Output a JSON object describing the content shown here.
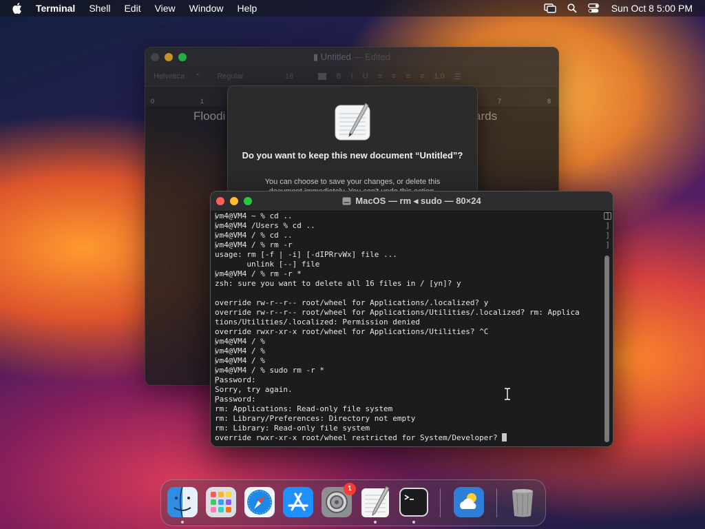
{
  "menubar": {
    "app_name": "Terminal",
    "items": [
      "Shell",
      "Edit",
      "View",
      "Window",
      "Help"
    ],
    "clock": "Sun Oct 8  5:00 PM"
  },
  "textedit": {
    "title": "Untitled",
    "title_suffix": " — Edited",
    "toolbar": {
      "font": "Helvetica",
      "style": "Regular",
      "size": "18",
      "spacing": "1.0"
    },
    "ruler_ticks": [
      "0",
      "1",
      "7",
      "8"
    ],
    "doc_text_left": "Floodi",
    "doc_text_right": "ards"
  },
  "save_sheet": {
    "heading": "Do you want to keep this new document “Untitled”?",
    "body": "You can choose to save your changes, or delete this document immediately. You can't undo this action."
  },
  "terminal": {
    "title": "MacOS — rm ◂ sudo — 80×24",
    "lines": [
      {
        "text": "vm4@VM4 ~ % cd ..",
        "mark": true
      },
      {
        "text": "vm4@VM4 /Users % cd ..",
        "mark": true
      },
      {
        "text": "vm4@VM4 / % cd ..",
        "mark": true
      },
      {
        "text": "vm4@VM4 / % rm -r",
        "mark": true
      },
      {
        "text": "usage: rm [-f | -i] [-dIPRrvWx] file ...",
        "mark": false
      },
      {
        "text": "       unlink [--] file",
        "mark": false
      },
      {
        "text": "vm4@VM4 / % rm -r *",
        "mark": true
      },
      {
        "text": "zsh: sure you want to delete all 16 files in / [yn]? y",
        "mark": false
      },
      {
        "text": "",
        "mark": false
      },
      {
        "text": "override rw-r--r-- root/wheel for Applications/.localized? y",
        "mark": false
      },
      {
        "text": "override rw-r--r-- root/wheel for Applications/Utilities/.localized? rm: Applica",
        "mark": false
      },
      {
        "text": "tions/Utilities/.localized: Permission denied",
        "mark": false
      },
      {
        "text": "override rwxr-xr-x root/wheel for Applications/Utilities? ^C",
        "mark": false
      },
      {
        "text": "vm4@VM4 / %",
        "mark": true
      },
      {
        "text": "vm4@VM4 / %",
        "mark": true
      },
      {
        "text": "vm4@VM4 / %",
        "mark": true
      },
      {
        "text": "vm4@VM4 / % sudo rm -r *",
        "mark": true
      },
      {
        "text": "Password:",
        "mark": true
      },
      {
        "text": "Sorry, try again.",
        "mark": false
      },
      {
        "text": "Password:",
        "mark": true
      },
      {
        "text": "rm: Applications: Read-only file system",
        "mark": false
      },
      {
        "text": "rm: Library/Preferences: Directory not empty",
        "mark": false
      },
      {
        "text": "rm: Library: Read-only file system",
        "mark": false
      },
      {
        "text": "override rwxr-xr-x root/wheel restricted for System/Developer? ",
        "mark": false,
        "cursor": true
      }
    ]
  },
  "dock": {
    "items": [
      {
        "name": "finder-icon",
        "running": true
      },
      {
        "name": "launchpad-icon",
        "running": false
      },
      {
        "name": "safari-icon",
        "running": false
      },
      {
        "name": "app-store-icon",
        "running": false
      },
      {
        "name": "system-settings-icon",
        "running": false,
        "badge": "1"
      },
      {
        "name": "textedit-icon",
        "running": true
      },
      {
        "name": "terminal-icon",
        "running": true
      },
      {
        "name": "weather-icon",
        "running": false
      },
      {
        "name": "trash-icon",
        "running": false
      }
    ]
  }
}
